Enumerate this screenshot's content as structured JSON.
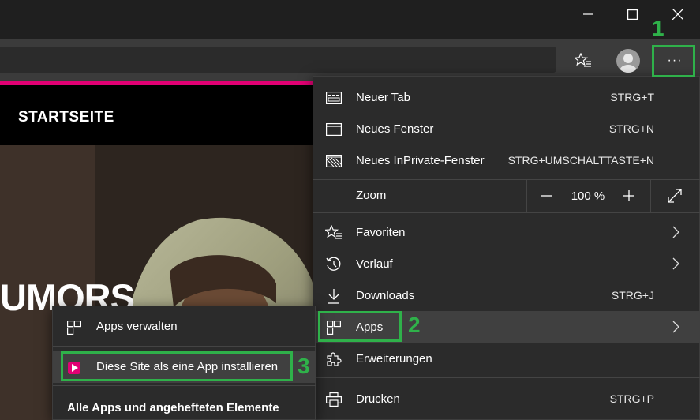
{
  "window": {
    "minimize_label": "minimize",
    "maximize_label": "maximize",
    "close_label": "close"
  },
  "toolbar": {
    "favorites_icon": "star-list-icon",
    "profile_icon": "avatar",
    "more_label": "···"
  },
  "page": {
    "header_title": "STARTSEITE",
    "hero_text": "UMORS"
  },
  "menu": {
    "new_tab": {
      "label": "Neuer Tab",
      "shortcut": "STRG+T"
    },
    "new_window": {
      "label": "Neues Fenster",
      "shortcut": "STRG+N"
    },
    "new_private": {
      "label": "Neues InPrivate-Fenster",
      "shortcut": "STRG+UMSCHALTTASTE+N"
    },
    "zoom": {
      "label": "Zoom",
      "value": "100 %",
      "minus": "−",
      "plus": "+"
    },
    "favorites": {
      "label": "Favoriten"
    },
    "history": {
      "label": "Verlauf"
    },
    "downloads": {
      "label": "Downloads",
      "shortcut": "STRG+J"
    },
    "apps": {
      "label": "Apps"
    },
    "extensions": {
      "label": "Erweiterungen"
    },
    "print": {
      "label": "Drucken",
      "shortcut": "STRG+P"
    }
  },
  "submenu": {
    "manage_apps": "Apps verwalten",
    "install_site": "Diese Site als eine App installieren",
    "heading": "Alle Apps und angehefteten Elemente"
  },
  "annotations": {
    "one": "1",
    "two": "2",
    "three": "3",
    "color": "#2fb14a"
  },
  "colors": {
    "brand_magenta": "#e20074",
    "menu_bg": "#2b2b2b",
    "highlight_bg": "#404040"
  }
}
